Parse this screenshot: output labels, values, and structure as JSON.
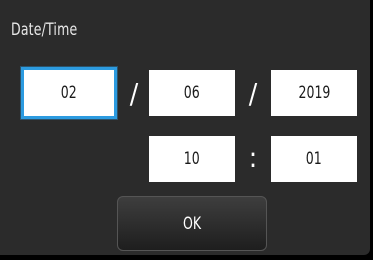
{
  "dialog": {
    "title": "Date/Time",
    "date": {
      "month": "02",
      "day": "06",
      "year": "2019",
      "separator": "/"
    },
    "time": {
      "hour": "10",
      "minute": "01",
      "separator": ":"
    },
    "ok_label": "OK"
  },
  "colors": {
    "background": "#2b2b2b",
    "field": "#ffffff",
    "selection_outline": "#2c9be0",
    "text_light": "#ffffff"
  }
}
